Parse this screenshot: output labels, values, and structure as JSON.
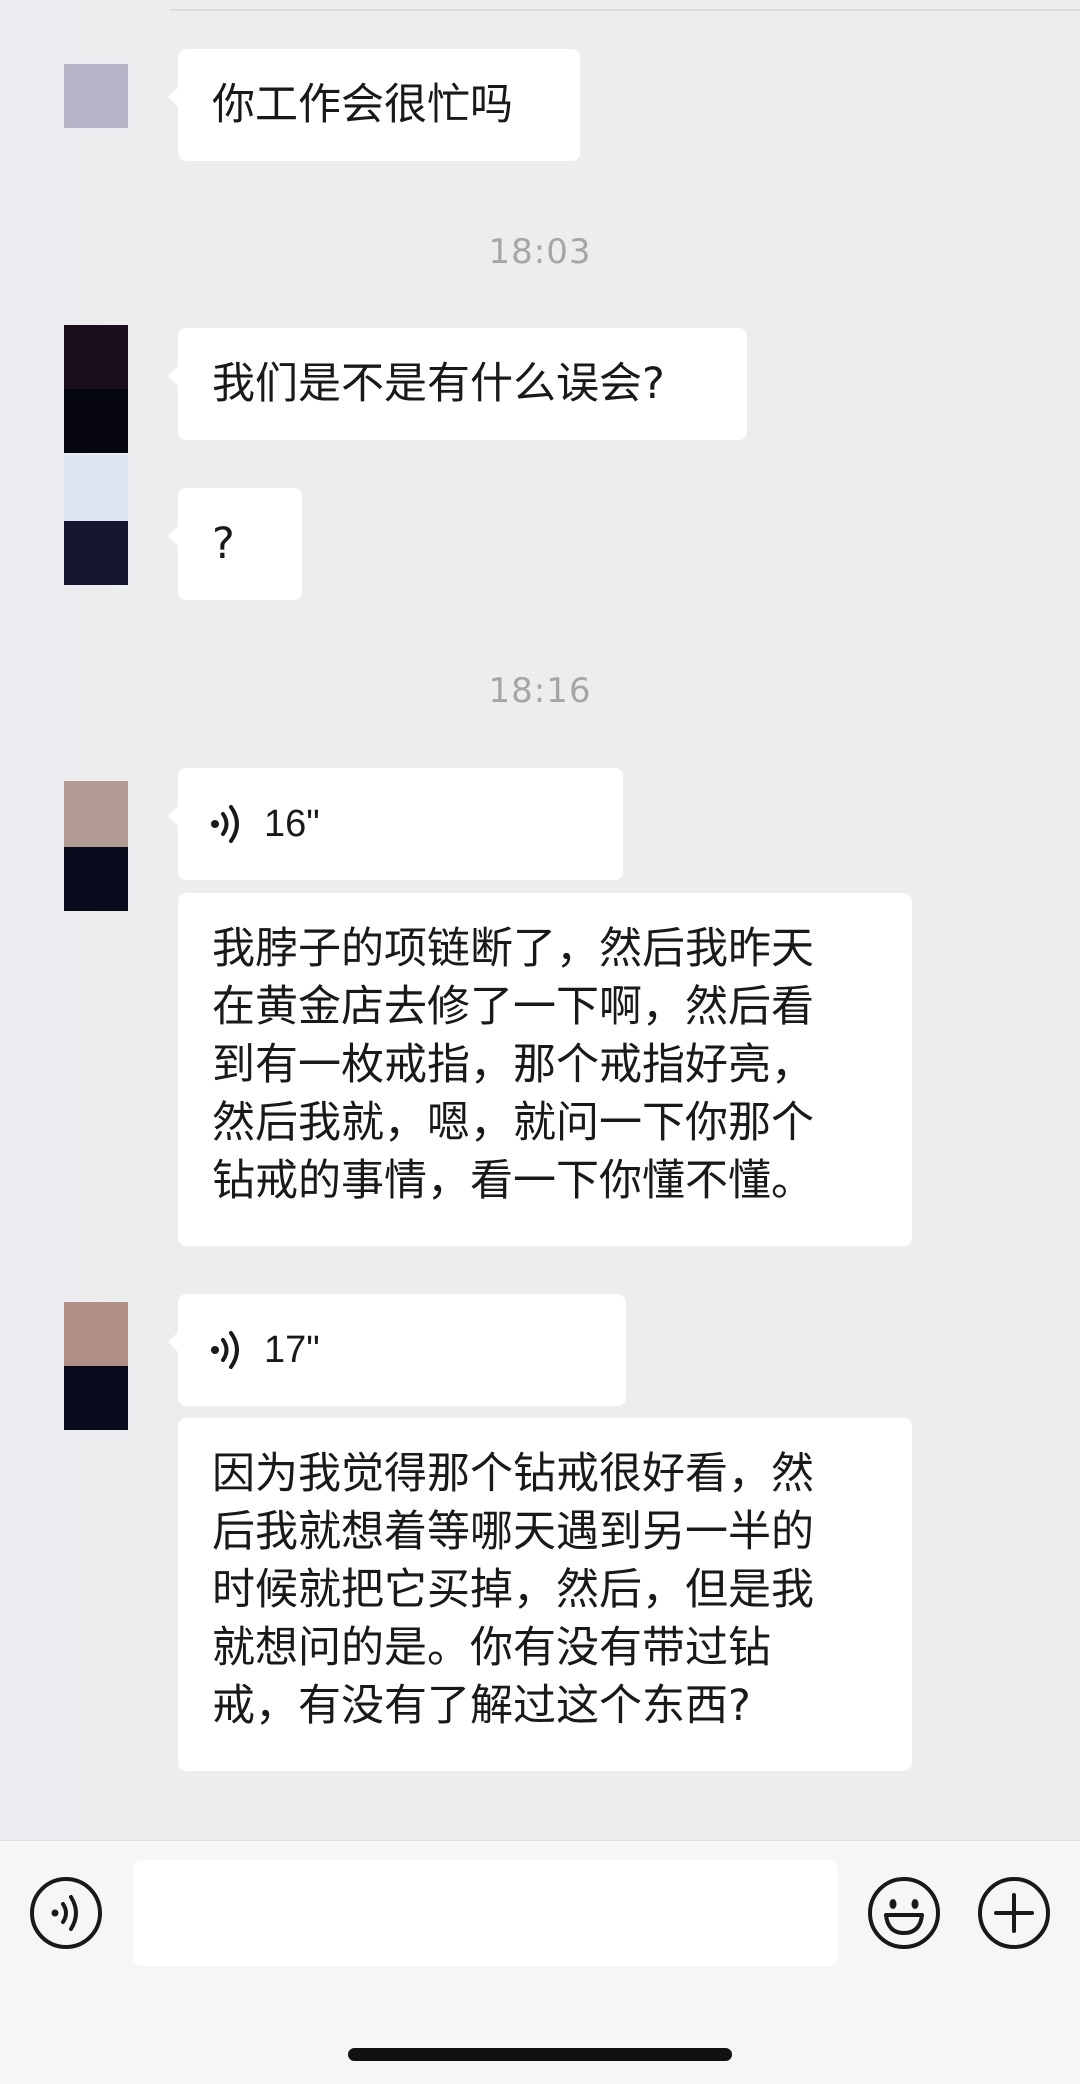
{
  "messages": [
    {
      "type": "text",
      "text": "你工作会很忙吗"
    },
    {
      "type": "time",
      "text": "18:03"
    },
    {
      "type": "text",
      "text": "我们是不是有什么误会?"
    },
    {
      "type": "text",
      "text": "?"
    },
    {
      "type": "time",
      "text": "18:16"
    },
    {
      "type": "voice",
      "duration": "16\"",
      "transcript": [
        "我脖子的项链断了，然后我昨天",
        "在黄金店去修了一下啊，然后看",
        "到有一枚戒指，那个戒指好亮，",
        "然后我就，嗯，就问一下你那个",
        "钻戒的事情，看一下你懂不懂。"
      ]
    },
    {
      "type": "voice",
      "duration": "17\"",
      "transcript": [
        "因为我觉得那个钻戒很好看，然",
        "后我就想着等哪天遇到另一半的",
        "时候就把它买掉，然后，但是我",
        "就想问的是。你有没有带过钻",
        "戒，有没有了解过这个东西?"
      ]
    }
  ],
  "input_bar": {
    "voice_icon": "voice-mode-icon",
    "emoji_icon": "emoji-icon",
    "plus_icon": "plus-icon",
    "text_value": ""
  },
  "colors": {
    "background": "#ededed",
    "bubble": "#ffffff",
    "timestamp": "#a6a6a6",
    "input_bar": "#f6f6f6"
  }
}
